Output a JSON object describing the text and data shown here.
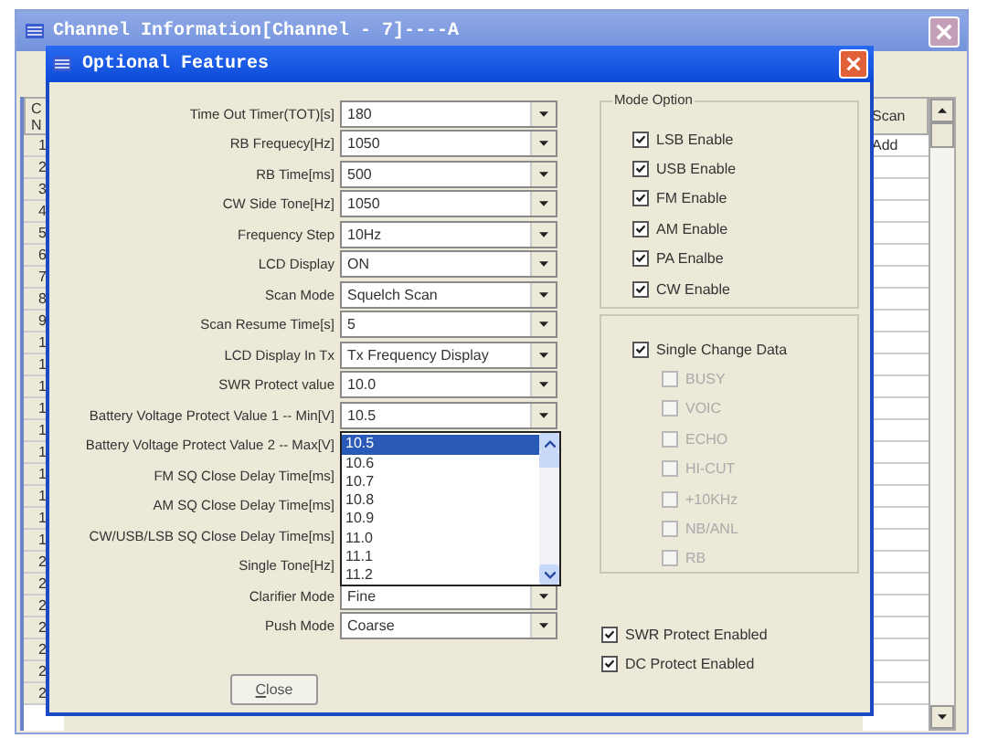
{
  "window": {
    "title": "Channel Information[Channel - 7]----A"
  },
  "background_table": {
    "column_1_header": [
      "C",
      "N"
    ],
    "column_1_rows": [
      "1",
      "2",
      "3",
      "4",
      "5",
      "6",
      "7",
      "8",
      "9",
      "1",
      "1",
      "1",
      "1",
      "1",
      "1",
      "1",
      "1",
      "1",
      "1",
      "2",
      "2",
      "2",
      "2",
      "2",
      "2",
      "2"
    ],
    "column_2_header": "Scan",
    "column_2_rows": [
      "Add"
    ]
  },
  "dialog": {
    "title": "Optional Features",
    "fields": [
      {
        "label": "Time Out Timer(TOT)[s]",
        "value": "180"
      },
      {
        "label": "RB Frequecy[Hz]",
        "value": "1050"
      },
      {
        "label": "RB Time[ms]",
        "value": "500"
      },
      {
        "label": "CW Side Tone[Hz]",
        "value": "1050"
      },
      {
        "label": "Frequency Step",
        "value": "10Hz"
      },
      {
        "label": "LCD Display",
        "value": "ON"
      },
      {
        "label": "Scan Mode",
        "value": "Squelch Scan"
      },
      {
        "label": "Scan Resume Time[s]",
        "value": "5"
      },
      {
        "label": "LCD Display In Tx",
        "value": "Tx Frequency Display"
      },
      {
        "label": "SWR Protect value",
        "value": "10.0"
      },
      {
        "label": "Battery Voltage Protect Value 1 -- Min[V]",
        "value": "10.5"
      },
      {
        "label": "Battery Voltage Protect Value 2 -- Max[V]",
        "list": [
          {
            "label": "10.5",
            "selected": true
          },
          {
            "label": "10.6",
            "selected": false
          },
          {
            "label": "10.7",
            "selected": false
          },
          {
            "label": "10.8",
            "selected": false
          },
          {
            "label": "10.9",
            "selected": false
          },
          {
            "label": "11.0",
            "selected": false
          },
          {
            "label": "11.1",
            "selected": false
          },
          {
            "label": "11.2",
            "selected": false
          }
        ]
      },
      {
        "label": "FM SQ Close Delay Time[ms]"
      },
      {
        "label": "AM SQ Close Delay Time[ms]"
      },
      {
        "label": "CW/USB/LSB SQ Close Delay Time[ms]"
      },
      {
        "label": "Single Tone[Hz]"
      },
      {
        "label": "Clarifier Mode",
        "value": "Fine"
      },
      {
        "label": "Push Mode",
        "value": "Coarse"
      }
    ],
    "mode_option": {
      "title": "Mode Option",
      "options": [
        {
          "label": "LSB Enable",
          "checked": true
        },
        {
          "label": "USB Enable",
          "checked": true
        },
        {
          "label": "FM Enable",
          "checked": true
        },
        {
          "label": "AM Enable",
          "checked": true
        },
        {
          "label": "PA Enalbe",
          "checked": true
        },
        {
          "label": "CW Enable",
          "checked": true
        }
      ]
    },
    "single_change": {
      "label": "Single Change Data",
      "checked": true,
      "children": [
        {
          "label": "BUSY",
          "checked": false,
          "disabled": true
        },
        {
          "label": "VOIC",
          "checked": false,
          "disabled": true
        },
        {
          "label": "ECHO",
          "checked": false,
          "disabled": true
        },
        {
          "label": "HI-CUT",
          "checked": false,
          "disabled": true
        },
        {
          "label": "+10KHz",
          "checked": false,
          "disabled": true
        },
        {
          "label": "NB/ANL",
          "checked": false,
          "disabled": true
        },
        {
          "label": "RB",
          "checked": false,
          "disabled": true
        }
      ]
    },
    "protects": [
      {
        "label": "SWR Protect Enabled",
        "checked": true
      },
      {
        "label": "DC Protect Enabled",
        "checked": true
      }
    ],
    "close_button": "Close"
  }
}
